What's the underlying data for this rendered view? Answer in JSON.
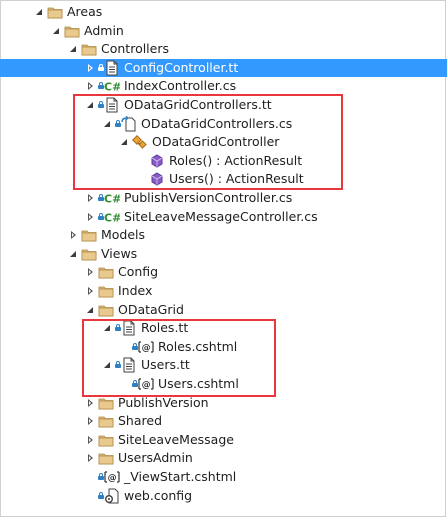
{
  "tree": [
    {
      "label": "Areas",
      "icon": "folder-icon",
      "expander": "expanded",
      "lock": false
    },
    {
      "label": "Admin",
      "icon": "folder-icon",
      "expander": "expanded",
      "lock": false
    },
    {
      "label": "Controllers",
      "icon": "folder-icon",
      "expander": "expanded",
      "lock": false
    },
    {
      "label": "ConfigController.tt",
      "icon": "text-template-file-icon",
      "expander": "collapsed",
      "lock": true,
      "selected": true
    },
    {
      "label": "IndexController.cs",
      "icon": "csharp-file-icon",
      "expander": "collapsed",
      "lock": true
    },
    {
      "label": "ODataGridControllers.tt",
      "icon": "text-template-file-icon",
      "expander": "expanded",
      "lock": true
    },
    {
      "label": "ODataGridControllers.cs",
      "icon": "generated-csharp-file-icon",
      "expander": "expanded",
      "lock": true
    },
    {
      "label": "ODataGridController",
      "icon": "class-icon",
      "expander": "expanded",
      "lock": false
    },
    {
      "label": "Roles() : ActionResult",
      "icon": "method-icon",
      "expander": "none",
      "lock": false
    },
    {
      "label": "Users() : ActionResult",
      "icon": "method-icon",
      "expander": "none",
      "lock": false
    },
    {
      "label": "PublishVersionController.cs",
      "icon": "csharp-file-icon",
      "expander": "collapsed",
      "lock": true
    },
    {
      "label": "SiteLeaveMessageController.cs",
      "icon": "csharp-file-icon",
      "expander": "collapsed",
      "lock": true
    },
    {
      "label": "Models",
      "icon": "folder-icon",
      "expander": "collapsed",
      "lock": false
    },
    {
      "label": "Views",
      "icon": "folder-icon",
      "expander": "expanded",
      "lock": false
    },
    {
      "label": "Config",
      "icon": "folder-icon",
      "expander": "collapsed",
      "lock": false
    },
    {
      "label": "Index",
      "icon": "folder-icon",
      "expander": "collapsed",
      "lock": false
    },
    {
      "label": "ODataGrid",
      "icon": "folder-icon",
      "expander": "expanded",
      "lock": false
    },
    {
      "label": "Roles.tt",
      "icon": "text-template-file-icon",
      "expander": "expanded",
      "lock": true
    },
    {
      "label": "Roles.cshtml",
      "icon": "razor-file-icon",
      "expander": "none",
      "lock": true
    },
    {
      "label": "Users.tt",
      "icon": "text-template-file-icon",
      "expander": "expanded",
      "lock": true
    },
    {
      "label": "Users.cshtml",
      "icon": "razor-file-icon",
      "expander": "none",
      "lock": true
    },
    {
      "label": "PublishVersion",
      "icon": "folder-icon",
      "expander": "collapsed",
      "lock": false
    },
    {
      "label": "Shared",
      "icon": "folder-icon",
      "expander": "collapsed",
      "lock": false
    },
    {
      "label": "SiteLeaveMessage",
      "icon": "folder-icon",
      "expander": "collapsed",
      "lock": false
    },
    {
      "label": "UsersAdmin",
      "icon": "folder-icon",
      "expander": "collapsed",
      "lock": false
    },
    {
      "label": "_ViewStart.cshtml",
      "icon": "razor-file-icon",
      "expander": "none",
      "lock": true
    },
    {
      "label": "web.config",
      "icon": "config-file-icon",
      "expander": "none",
      "lock": true
    }
  ],
  "colors": {
    "selection": "#3399ff",
    "highlight_box": "#e8383d",
    "folder": "#dcb67a",
    "csharp": "#2f8f2f",
    "method": "#8a5cc7",
    "lock": "#2e7fc4"
  }
}
